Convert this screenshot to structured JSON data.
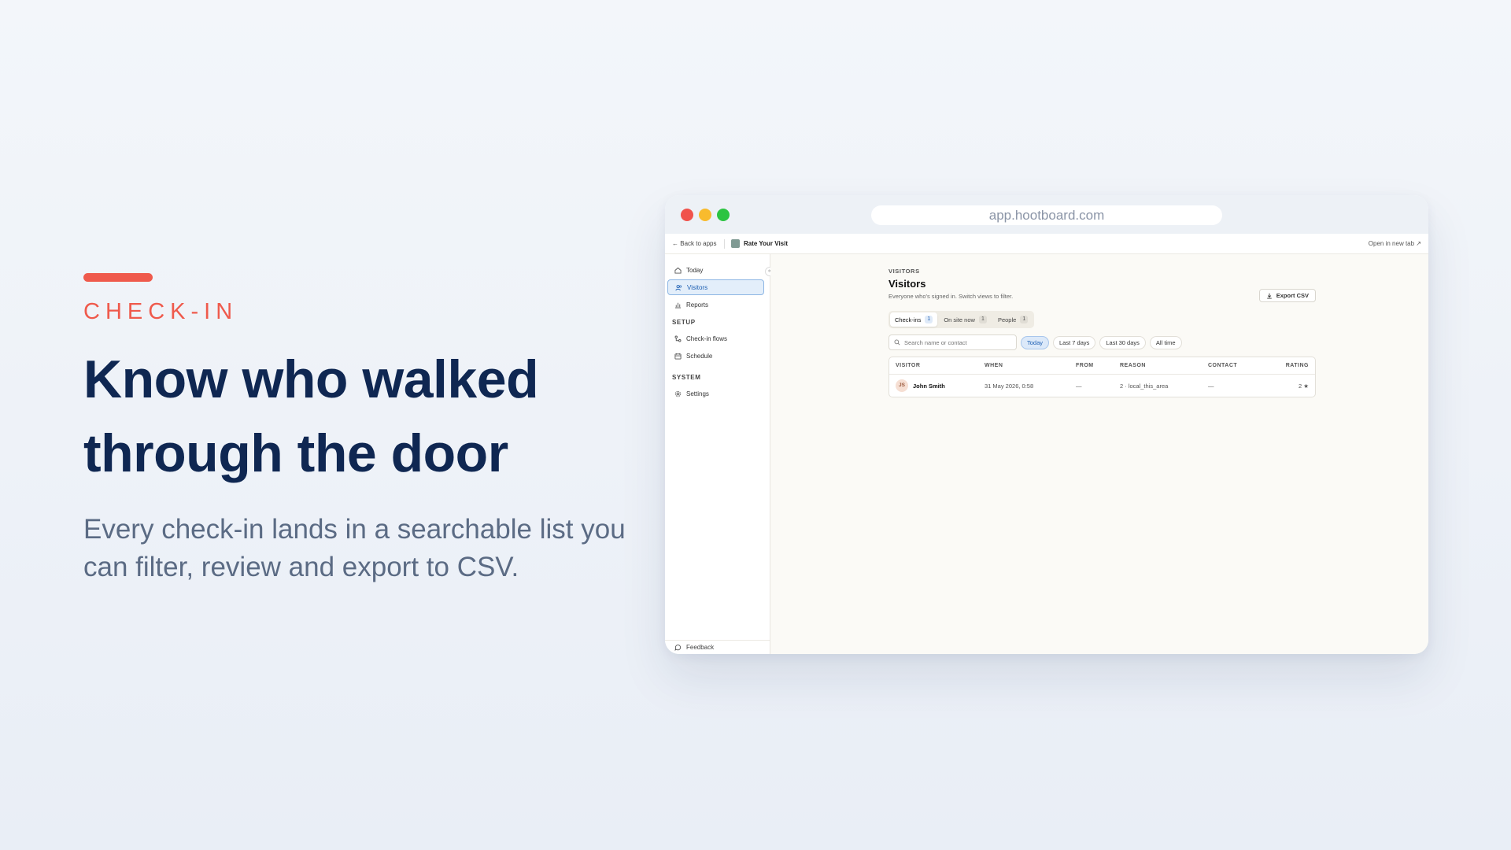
{
  "hero": {
    "eyebrow": "CHECK-IN",
    "headline_line1": "Know who walked",
    "headline_line2": "through the door",
    "subhead": "Every check-in lands in a searchable list you can filter, review and export to CSV."
  },
  "browser": {
    "url": "app.hootboard.com"
  },
  "appbar": {
    "back_label": "Back to apps",
    "app_name": "Rate Your Visit",
    "open_new_tab": "Open in new tab"
  },
  "sidebar": {
    "items": [
      {
        "label": "Today",
        "icon": "home-icon"
      },
      {
        "label": "Visitors",
        "icon": "users-icon",
        "active": true
      },
      {
        "label": "Reports",
        "icon": "bar-chart-icon"
      }
    ],
    "setup_title": "SETUP",
    "setup_items": [
      {
        "label": "Check-in flows",
        "icon": "flow-icon"
      },
      {
        "label": "Schedule",
        "icon": "calendar-icon"
      }
    ],
    "system_title": "SYSTEM",
    "system_items": [
      {
        "label": "Settings",
        "icon": "gear-icon"
      }
    ],
    "feedback_label": "Feedback"
  },
  "main": {
    "eyebrow": "VISITORS",
    "title": "Visitors",
    "description": "Everyone who's signed in. Switch views to filter.",
    "export_label": "Export CSV",
    "tabs": [
      {
        "label": "Check-ins",
        "count": "1",
        "active": true
      },
      {
        "label": "On site now",
        "count": "1"
      },
      {
        "label": "People",
        "count": "1"
      }
    ],
    "search_placeholder": "Search name or contact",
    "range_chips": [
      {
        "label": "Today",
        "active": true
      },
      {
        "label": "Last 7 days"
      },
      {
        "label": "Last 30 days"
      },
      {
        "label": "All time"
      }
    ],
    "table": {
      "columns": [
        "VISITOR",
        "WHEN",
        "FROM",
        "REASON",
        "CONTACT",
        "RATING"
      ],
      "rows": [
        {
          "initials": "JS",
          "name": "John Smith",
          "when": "31 May 2026, 0:58",
          "from": "—",
          "reason": "2 · local_this_area",
          "contact": "—",
          "rating": "2 ★"
        }
      ]
    }
  },
  "colors": {
    "accent": "#ef5a4c",
    "headline": "#0f2752",
    "active_blue": "#1d5fb3"
  }
}
